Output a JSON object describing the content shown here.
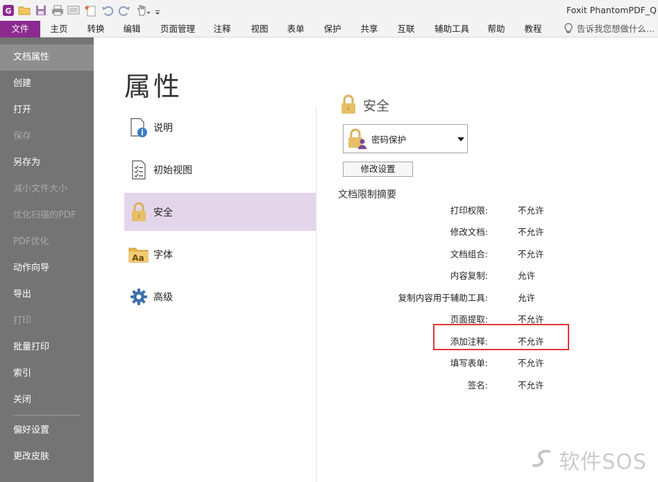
{
  "app_title": "Foxit PhantomPDF_Q",
  "ribbon": {
    "tabs": [
      {
        "label": "文件"
      },
      {
        "label": "主页"
      },
      {
        "label": "转换"
      },
      {
        "label": "编辑"
      },
      {
        "label": "页面管理"
      },
      {
        "label": "注释"
      },
      {
        "label": "视图"
      },
      {
        "label": "表单"
      },
      {
        "label": "保护"
      },
      {
        "label": "共享"
      },
      {
        "label": "互联"
      },
      {
        "label": "辅助工具"
      },
      {
        "label": "帮助"
      },
      {
        "label": "教程"
      }
    ],
    "tell_me": "告诉我您想做什么..."
  },
  "sidebar": {
    "items": [
      {
        "label": "文档属性"
      },
      {
        "label": "创建"
      },
      {
        "label": "打开"
      },
      {
        "label": "保存"
      },
      {
        "label": "另存为"
      },
      {
        "label": "减小文件大小"
      },
      {
        "label": "优化扫描的PDF"
      },
      {
        "label": "PDF优化"
      },
      {
        "label": "动作向导"
      },
      {
        "label": "导出"
      },
      {
        "label": "打印"
      },
      {
        "label": "批量打印"
      },
      {
        "label": "索引"
      },
      {
        "label": "关闭"
      },
      {
        "label": "偏好设置"
      },
      {
        "label": "更改皮肤"
      }
    ]
  },
  "page": {
    "title": "属性",
    "nav": [
      {
        "label": "说明"
      },
      {
        "label": "初始视图"
      },
      {
        "label": "安全"
      },
      {
        "label": "字体"
      },
      {
        "label": "高级"
      }
    ]
  },
  "security": {
    "heading": "安全",
    "method": "密码保护",
    "change_button": "修改设置",
    "summary_title": "文档限制摘要",
    "rows": [
      {
        "label": "打印权限:",
        "value": "不允许"
      },
      {
        "label": "修改文档:",
        "value": "不允许"
      },
      {
        "label": "文档组合:",
        "value": "不允许"
      },
      {
        "label": "内容复制:",
        "value": "允许"
      },
      {
        "label": "复制内容用于辅助工具:",
        "value": "允许"
      },
      {
        "label": "页面提取:",
        "value": "不允许"
      },
      {
        "label": "添加注释:",
        "value": "不允许"
      },
      {
        "label": "填写表单:",
        "value": "不允许"
      },
      {
        "label": "签名:",
        "value": "不允许"
      }
    ]
  },
  "watermark": "软件SOS",
  "colors": {
    "file_tab": "#8b2b8f",
    "sidebar": "#747474",
    "selected_nav": "#e3d5ea",
    "highlight_box": "#e03535",
    "lock_gold": "#e0b860"
  }
}
